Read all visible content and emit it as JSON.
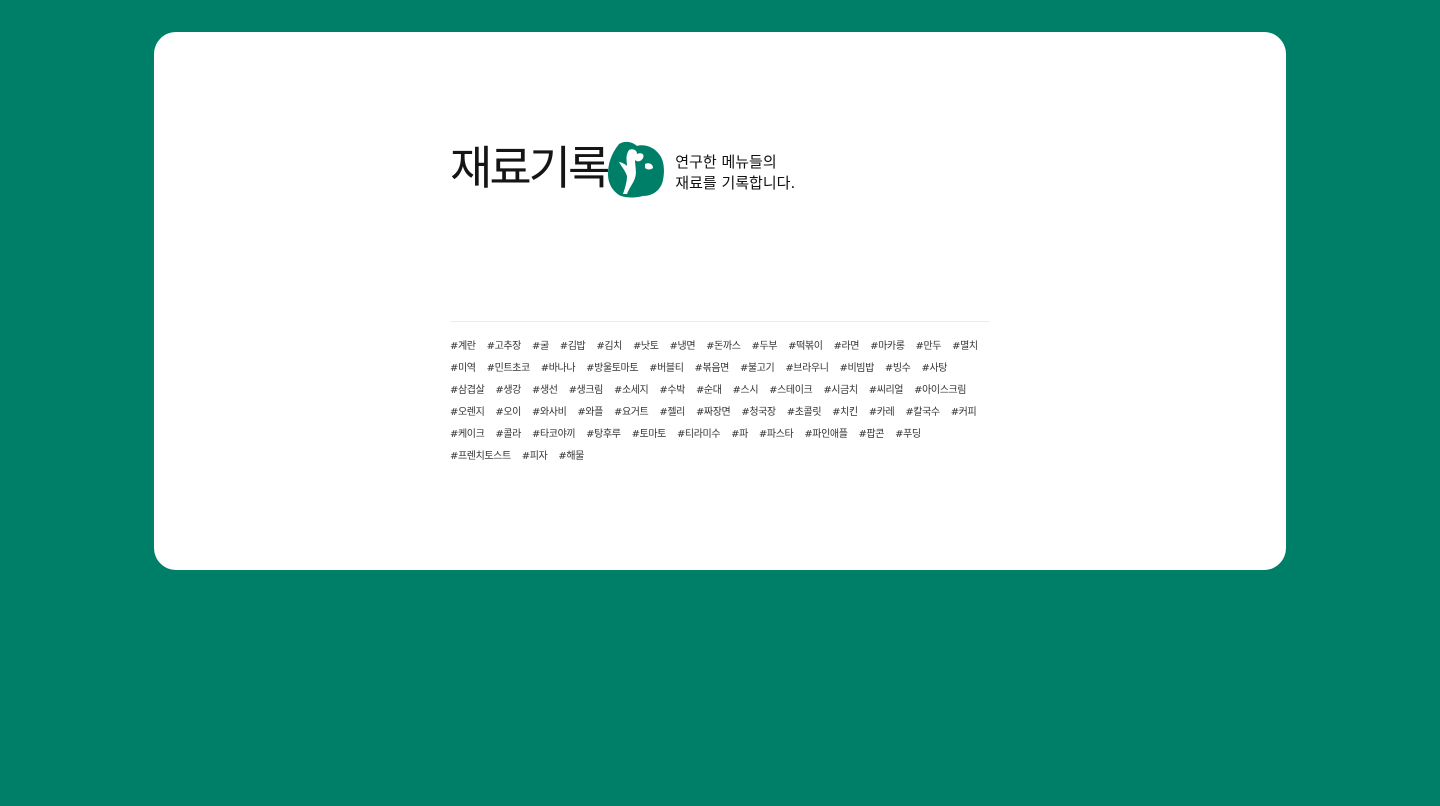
{
  "colors": {
    "background": "#007F68",
    "card": "#FFFFFF",
    "logo_mark": "#007F68",
    "text": "#151515",
    "tag_text": "#333333"
  },
  "header": {
    "logo_text": "재료기록",
    "logo_icon": "green-blob-figure-icon",
    "tagline_line1": "연구한 메뉴들의",
    "tagline_line2": "재료를 기록합니다."
  },
  "tags": [
    "#계란",
    "#고추장",
    "#굴",
    "#김밥",
    "#김치",
    "#낫토",
    "#냉면",
    "#돈까스",
    "#두부",
    "#떡볶이",
    "#라면",
    "#마카롱",
    "#만두",
    "#멸치",
    "#미역",
    "#민트초코",
    "#바나나",
    "#방울토마토",
    "#버블티",
    "#볶음면",
    "#불고기",
    "#브라우니",
    "#비빔밥",
    "#빙수",
    "#사탕",
    "#삼겹살",
    "#생강",
    "#생선",
    "#생크림",
    "#소세지",
    "#수박",
    "#순대",
    "#스시",
    "#스테이크",
    "#시금치",
    "#씨리얼",
    "#아이스크림",
    "#오렌지",
    "#오이",
    "#와사비",
    "#와플",
    "#요거트",
    "#젤리",
    "#짜장면",
    "#청국장",
    "#초콜릿",
    "#치킨",
    "#카레",
    "#칼국수",
    "#커피",
    "#케이크",
    "#콜라",
    "#타코야끼",
    "#탕후루",
    "#토마토",
    "#티라미수",
    "#파",
    "#파스타",
    "#파인애플",
    "#팝콘",
    "#푸딩",
    "#프렌치토스트",
    "#피자",
    "#해물"
  ]
}
